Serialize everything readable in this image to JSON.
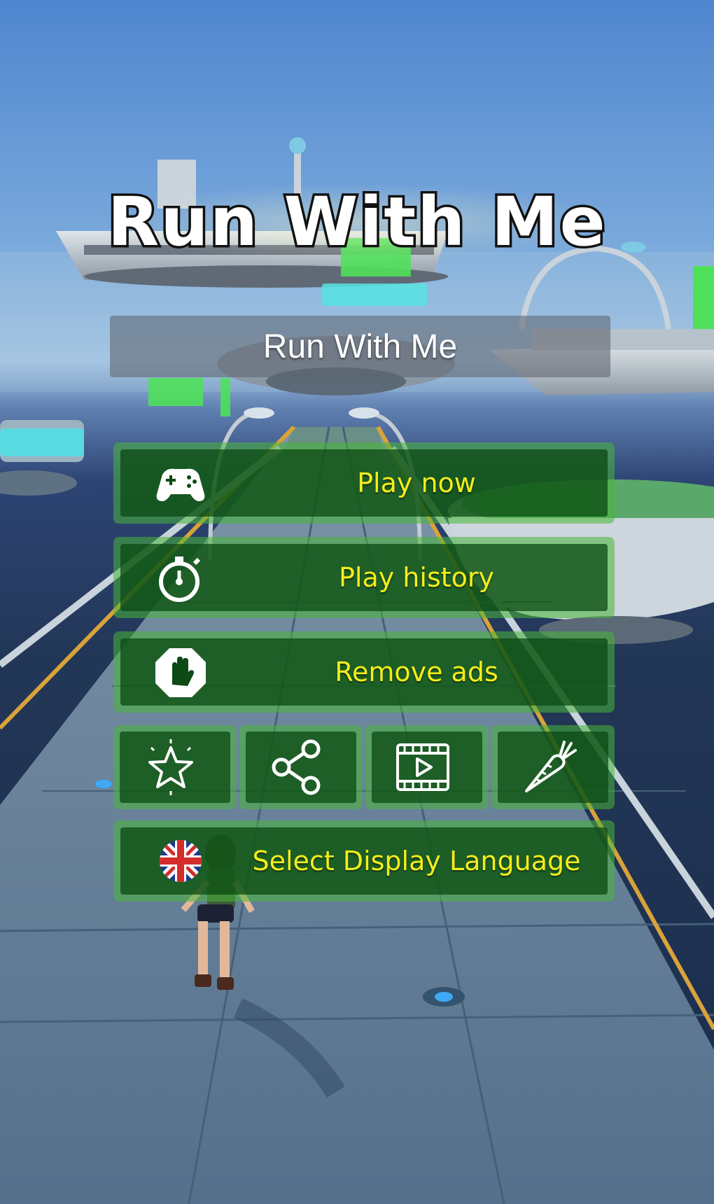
{
  "app": {
    "logo_text": "Run With Me",
    "subtitle": "Run With Me"
  },
  "menu": {
    "play_now": {
      "label": "Play now",
      "icon": "gamepad-icon"
    },
    "play_history": {
      "label": "Play history",
      "icon": "stopwatch-icon"
    },
    "remove_ads": {
      "label": "Remove ads",
      "icon": "stop-hand-icon"
    },
    "select_language": {
      "label": "Select Display Language",
      "icon": "uk-flag-icon"
    }
  },
  "icon_buttons": [
    {
      "icon": "star-icon"
    },
    {
      "icon": "share-icon"
    },
    {
      "icon": "video-icon"
    },
    {
      "icon": "carrot-icon"
    }
  ],
  "colors": {
    "button_text": "#f3ee1a",
    "button_border": "#48b638",
    "button_fill": "#0a4812"
  }
}
